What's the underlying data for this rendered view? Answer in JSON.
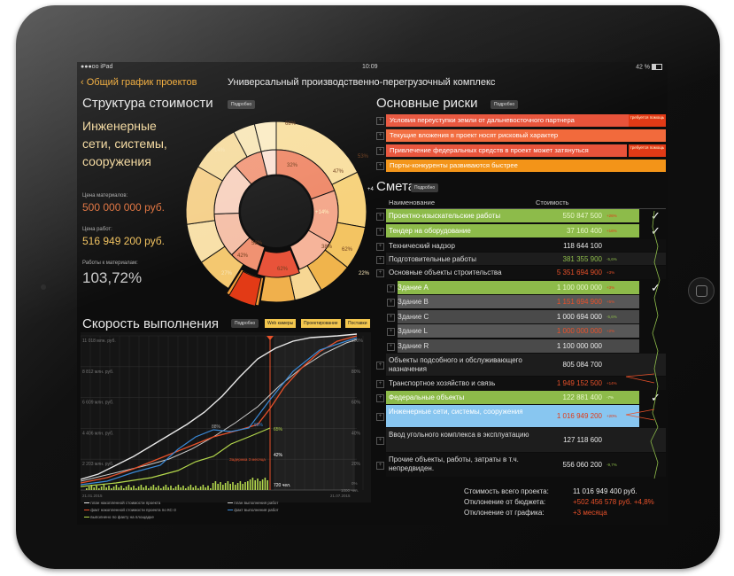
{
  "status": {
    "carrier": "●●●oo iPad",
    "time": "10:09",
    "battery": "42 %"
  },
  "nav": {
    "back": "Общий график проектов",
    "title": "Универсальный производственно-перегрузочный комплекс"
  },
  "cost": {
    "title": "Структура стоимости",
    "details": "Подробно",
    "category": "Инженерные сети, системы, сооружения",
    "kpis": [
      {
        "label": "Цена материалов:",
        "value": "500 000 000 руб.",
        "color": "#e0703a"
      },
      {
        "label": "Цена работ:",
        "value": "516 949 200 руб.",
        "color": "#f2c25c"
      },
      {
        "label": "Работы к материалам:",
        "value": "103,72%",
        "color": "#cccccc"
      }
    ],
    "donut_labels": [
      "14%",
      "38%",
      "19%",
      "27%",
      "42%",
      "62%",
      "68%",
      "32%",
      "58%",
      "+14%",
      "47%",
      "38%",
      "62%",
      "53%",
      "+49%",
      "22%",
      "20%"
    ]
  },
  "speed": {
    "title": "Скорость выполнения",
    "details": "Подробно",
    "tags": [
      "Web камеры",
      "Проектирование",
      "Поставки"
    ],
    "y_labels": [
      "11 018 млн. руб.",
      "8 812 млн. руб.",
      "6 609 млн. руб.",
      "4 406 млн. руб.",
      "2 203 млн. руб."
    ],
    "r_labels": [
      "100%",
      "80%",
      "60%",
      "40%",
      "20%"
    ],
    "series_labels": [
      "88%",
      "85%",
      "65%",
      "42%"
    ],
    "marker_label": "Задержка 3 месяца",
    "bars_label": "720 чел.",
    "count_label": "1000 чел.",
    "zero": "0%",
    "date_start": "21.01.2015",
    "date_end": "21.07.2015",
    "legend": [
      {
        "text": "план накопленной стоимости проекта",
        "color": "#e8e8e8"
      },
      {
        "text": "план выполнения работ",
        "color": "#cccccc"
      },
      {
        "text": "факт накопленной стоимости проекта по КС-3",
        "color": "#e8512a"
      },
      {
        "text": "факт выполнения работ",
        "color": "#3a8ad8"
      },
      {
        "text": "выполнено по факту на площадке",
        "color": "#b4d84c"
      }
    ]
  },
  "risks": {
    "title": "Основные риски",
    "details": "Подробно",
    "items": [
      {
        "text": "Условия переуступки земли от дальневосточного партнера",
        "color": "#e8533a",
        "tag": "требуется помощь"
      },
      {
        "text": "Текущие вложения в проект носят рисковый характер",
        "color": "#f26a3c",
        "tag": ""
      },
      {
        "text": "Привлечение федеральных средств в проект может затянуться",
        "color": "#e8533a",
        "tag": "требуется помощь"
      },
      {
        "text": "Порты-конкуренты развиваются быстрее",
        "color": "#f39418",
        "tag": ""
      }
    ]
  },
  "estimate": {
    "title": "Смета",
    "details": "Подробно",
    "col_name": "Наименование",
    "col_cost": "Стоимость",
    "rows": [
      {
        "name": "Проектно-изыскательские работы",
        "value": "550 847 500",
        "pct": "+26%",
        "bg": "#8dbb4a",
        "val_color": "#e8f6c8",
        "pct_color": "#e23a16",
        "check": "✓",
        "sub": false
      },
      {
        "name": "Тендер на оборудование",
        "value": "37 160 400",
        "pct": "+16%",
        "bg": "#8dbb4a",
        "val_color": "#e8f6c8",
        "pct_color": "#e23a16",
        "check": "✓",
        "sub": false
      },
      {
        "name": "Технический надзор",
        "value": "118 644 100",
        "pct": "",
        "bg": "#101010",
        "val_color": "#e8e8e8",
        "pct_color": "#e8e8e8",
        "check": "",
        "sub": false
      },
      {
        "name": "Подготовительные работы",
        "value": "381 355 900",
        "pct": "-5,6%",
        "bg": "#1d1d1d",
        "val_color": "#8dbb4a",
        "pct_color": "#8dbb4a",
        "check": "",
        "sub": false
      },
      {
        "name": "Основные объекты строительства",
        "value": "5 351 694 900",
        "pct": "+3%",
        "bg": "#101010",
        "val_color": "#e8512a",
        "pct_color": "#e8512a",
        "check": "",
        "sub": false
      },
      {
        "name": "Здание А",
        "value": "1 100 000 000",
        "pct": "+3%",
        "bg": "#8dbb4a",
        "val_color": "#e8f6c8",
        "pct_color": "#e23a16",
        "check": "✓",
        "sub": true
      },
      {
        "name": "Здание В",
        "value": "1 151 694 900",
        "pct": "+5%",
        "bg": "#585858",
        "val_color": "#e8512a",
        "pct_color": "#e8512a",
        "check": "",
        "sub": true
      },
      {
        "name": "Здание С",
        "value": "1 000 694 000",
        "pct": "-5,6%",
        "bg": "#4a4a4a",
        "val_color": "#e8e8e8",
        "pct_color": "#8dbb4a",
        "check": "",
        "sub": true
      },
      {
        "name": "Здание L",
        "value": "1 000 000 000",
        "pct": "+2%",
        "bg": "#585858",
        "val_color": "#e8512a",
        "pct_color": "#e8512a",
        "check": "",
        "sub": true
      },
      {
        "name": "Здание R",
        "value": "1 100 000 000",
        "pct": "",
        "bg": "#4a4a4a",
        "val_color": "#e8e8e8",
        "pct_color": "#e8e8e8",
        "check": "",
        "sub": true
      },
      {
        "name": "Объекты подсобного и обслуживающего назначения",
        "value": "805 084 700",
        "pct": "",
        "bg": "#1d1d1d",
        "val_color": "#e8e8e8",
        "pct_color": "#e8e8e8",
        "check": "",
        "sub": false
      },
      {
        "name": "Транспортное хозяйство и связь",
        "value": "1 949 152 500",
        "pct": "+14%",
        "bg": "#101010",
        "val_color": "#e8512a",
        "pct_color": "#e8512a",
        "check": "",
        "sub": false
      },
      {
        "name": "Федеральные объекты",
        "value": "122 881 400",
        "pct": "-7%",
        "bg": "#8dbb4a",
        "val_color": "#e8f6c8",
        "pct_color": "#e8f6c8",
        "check": "✓",
        "sub": false
      },
      {
        "name": "Инженерные сети, системы, сооружения",
        "value": "1 016 949 200",
        "pct": "+20%",
        "bg": "#88c6f0",
        "val_color": "#e23a16",
        "pct_color": "#e23a16",
        "check": "",
        "sub": false
      },
      {
        "name": "Ввод угольного комплекса в эксплуатацию",
        "value": "127 118 600",
        "pct": "",
        "bg": "#1d1d1d",
        "val_color": "#e8e8e8",
        "pct_color": "#e8e8e8",
        "check": "",
        "sub": false
      },
      {
        "name": "Прочие объекты, работы, затраты в т.ч. непредвиден.",
        "value": "556 060 200",
        "pct": "-9,7%",
        "bg": "#101010",
        "val_color": "#e8e8e8",
        "pct_color": "#8dbb4a",
        "check": "",
        "sub": false
      }
    ],
    "totals": [
      {
        "label": "Стоимость всего проекта:",
        "value": "11 016 949 400 руб.",
        "color": "#e8e8e8"
      },
      {
        "label": "Отклонение от бюджета:",
        "value": "+502 456 578 руб. +4,8%",
        "color": "#e8512a"
      },
      {
        "label": "Отклонение от графика:",
        "value": "+3 месяца",
        "color": "#e8512a"
      }
    ]
  },
  "icons": {
    "back": "chevron-left-icon",
    "home": "home-button-icon",
    "check": "checkmark-icon",
    "expand": "plus-box-icon"
  }
}
